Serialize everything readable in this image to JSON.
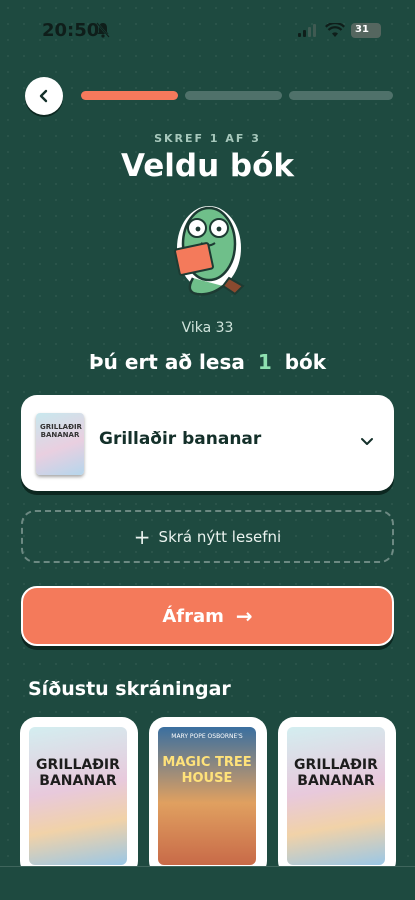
{
  "status": {
    "time": "20:50",
    "battery": "31"
  },
  "progress": {
    "current_step": 1,
    "total_steps": 3
  },
  "header": {
    "step_label": "SKREF 1 AF 3",
    "title": "Veldu bók"
  },
  "week_label": "Vika 33",
  "reading": {
    "prefix": "Þú ert að lesa",
    "count": "1",
    "suffix": "bók"
  },
  "book_select": {
    "selected": "Grillaðir bananar"
  },
  "new_material_button": {
    "plus": "+",
    "label": "Skrá nýtt lesefni"
  },
  "continue_button": {
    "label": "Áfram",
    "arrow": "→"
  },
  "recent": {
    "title": "Síðustu skráningar",
    "items": [
      {
        "cover_title": "GRILLAÐIR BANANAR"
      },
      {
        "cover_title": "MAGIC TREE HOUSE",
        "cover_subtitle": "MARY POPE OSBORNE'S"
      },
      {
        "cover_title": "GRILLAÐIR BANANAR"
      }
    ]
  },
  "icons": [
    "back-arrow-icon",
    "chevron-down-icon",
    "plus-icon",
    "arrow-right-icon",
    "bell-off-icon",
    "signal-icon",
    "wifi-icon",
    "battery-icon"
  ],
  "colors": {
    "background": "#1e4a40",
    "accent": "#f47a5b",
    "highlight": "#8ee0b0"
  }
}
